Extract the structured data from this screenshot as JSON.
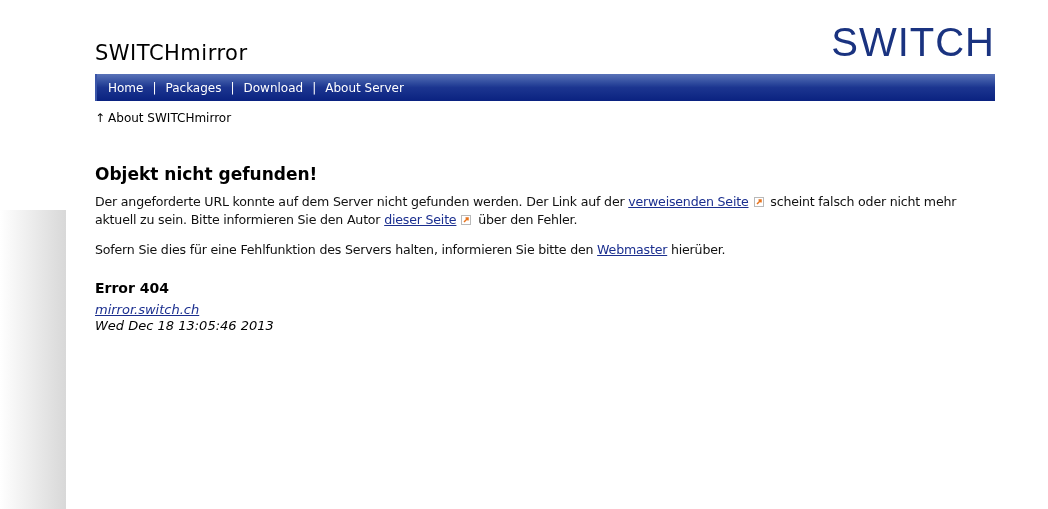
{
  "header": {
    "site_title": "SWITCHmirror",
    "logo": "SWITCH"
  },
  "nav": [
    {
      "label": "Home"
    },
    {
      "label": "Packages"
    },
    {
      "label": "Download"
    },
    {
      "label": "About Server"
    }
  ],
  "nav_separator": "|",
  "breadcrumb": {
    "arrow": "↑",
    "label": "About SWITCHmirror"
  },
  "heading": "Objekt nicht gefunden!",
  "paragraphs": [
    [
      {
        "kind": "text",
        "text": "Der angeforderte URL konnte auf dem Server nicht gefunden werden. Der Link auf der "
      },
      {
        "kind": "external_link",
        "text": "verweisenden Seite"
      },
      {
        "kind": "text",
        "text": " scheint falsch oder nicht mehr aktuell zu sein. Bitte informieren Sie den Autor "
      },
      {
        "kind": "external_link",
        "text": "dieser Seite"
      },
      {
        "kind": "text",
        "text": " über den Fehler."
      }
    ],
    [
      {
        "kind": "text",
        "text": "Sofern Sie dies für eine Fehlfunktion des Servers halten, informieren Sie bitte den "
      },
      {
        "kind": "link",
        "text": "Webmaster"
      },
      {
        "kind": "text",
        "text": " hierüber."
      }
    ]
  ],
  "error": {
    "title": "Error 404",
    "host": "mirror.switch.ch",
    "date": "Wed Dec 18 13:05:46 2013"
  }
}
